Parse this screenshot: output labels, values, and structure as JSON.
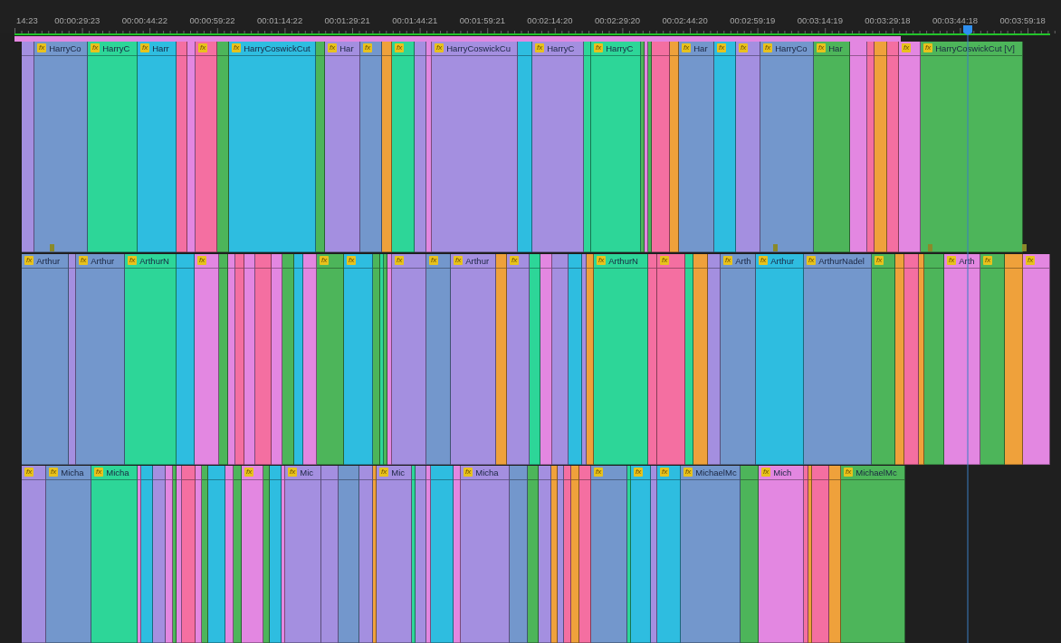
{
  "ruler": {
    "timecodes": [
      "14:23",
      "00:00:29:23",
      "00:00:44:22",
      "00:00:59:22",
      "00:01:14:22",
      "00:01:29:21",
      "00:01:44:21",
      "00:01:59:21",
      "00:02:14:20",
      "00:02:29:20",
      "00:02:44:20",
      "00:02:59:19",
      "00:03:14:19",
      "00:03:29:18",
      "00:03:44:18",
      "00:03:59:18"
    ]
  },
  "tracks": [
    {
      "clips": [
        {
          "color": "#a48fe0"
        },
        {
          "color": "#7397cc",
          "badge": "fx",
          "label": "HarryCo"
        },
        {
          "color": "#2dd698",
          "badge": "fx",
          "label": "HarryC"
        },
        {
          "color": "#2ebde0",
          "badge": "fx",
          "label": "Harr"
        },
        {
          "color": "#f46fa1"
        },
        {
          "color": "#e387e1"
        },
        {
          "color": "#f46fa1",
          "badge": "fx"
        },
        {
          "color": "#4db55a"
        },
        {
          "color": "#2ebde0",
          "badge": "fx",
          "label": "HarryCoswickCut"
        },
        {
          "color": "#4db55a"
        },
        {
          "color": "#a48fe0",
          "badge": "fx",
          "label": "Har"
        },
        {
          "color": "#7397cc",
          "badge": "fx"
        },
        {
          "color": "#efa13b"
        },
        {
          "color": "#2dd698",
          "badge": "fx"
        },
        {
          "color": "#a48fe0"
        },
        {
          "color": "#e387e1"
        },
        {
          "color": "#a48fe0",
          "badge": "fx",
          "label": "HarryCoswickCu"
        },
        {
          "color": "#2ebde0"
        },
        {
          "color": "#a48fe0",
          "badge": "fx",
          "label": "HarryC"
        },
        {
          "color": "#2dd698"
        },
        {
          "color": "#2dd698",
          "badge": "fx",
          "label": "HarryC"
        },
        {
          "color": "#4db55a"
        },
        {
          "color": "#e387e1"
        },
        {
          "color": "#4db55a"
        },
        {
          "color": "#f46fa1"
        },
        {
          "color": "#efa13b"
        },
        {
          "color": "#7397cc",
          "badge": "fx",
          "label": "Har"
        },
        {
          "color": "#2ebde0",
          "badge": "fx"
        },
        {
          "color": "#a48fe0",
          "badge": "fx"
        },
        {
          "color": "#7397cc",
          "badge": "fx",
          "label": "HarryCo"
        },
        {
          "color": "#4db55a",
          "badge": "fx",
          "label": "Har"
        },
        {
          "color": "#e387e1"
        },
        {
          "color": "#f46fa1"
        },
        {
          "color": "#efa13b"
        },
        {
          "color": "#f46fa1"
        },
        {
          "color": "#e387e1",
          "badge": "fx"
        },
        {
          "color": "#4db55a",
          "badge": "fx",
          "label": "HarryCoswickCut [V]"
        }
      ]
    },
    {
      "clips": [
        {
          "color": "#7397cc",
          "badge": "fx",
          "label": "Arthur"
        },
        {
          "color": "#a48fe0"
        },
        {
          "color": "#7397cc",
          "badge": "fx",
          "label": "Arthur"
        },
        {
          "color": "#2dd698",
          "badge": "fx",
          "label": "ArthurN"
        },
        {
          "color": "#2ebde0"
        },
        {
          "color": "#e387e1",
          "badge": "fx"
        },
        {
          "color": "#4db55a"
        },
        {
          "color": "#e387e1"
        },
        {
          "color": "#f46fa1"
        },
        {
          "color": "#e387e1"
        },
        {
          "color": "#f46fa1"
        },
        {
          "color": "#e387e1"
        },
        {
          "color": "#4db55a"
        },
        {
          "color": "#2ebde0"
        },
        {
          "color": "#e387e1"
        },
        {
          "color": "#4db55a",
          "badge": "fx"
        },
        {
          "color": "#2ebde0",
          "badge": "fx"
        },
        {
          "color": "#4db55a"
        },
        {
          "color": "#2dd698"
        },
        {
          "color": "#4db55a"
        },
        {
          "color": "#e387e1"
        },
        {
          "color": "#a48fe0",
          "badge": "fx"
        },
        {
          "color": "#7397cc",
          "badge": "fx"
        },
        {
          "color": "#a48fe0",
          "badge": "fx",
          "label": "Arthur"
        },
        {
          "color": "#efa13b"
        },
        {
          "color": "#a48fe0",
          "badge": "fx"
        },
        {
          "color": "#2dd698"
        },
        {
          "color": "#e387e1"
        },
        {
          "color": "#a48fe0"
        },
        {
          "color": "#2ebde0"
        },
        {
          "color": "#a48fe0"
        },
        {
          "color": "#efa13b"
        },
        {
          "color": "#2dd698",
          "badge": "fx",
          "label": "ArthurN"
        },
        {
          "color": "#f46fa1"
        },
        {
          "color": "#f46fa1",
          "badge": "fx"
        },
        {
          "color": "#2dd698"
        },
        {
          "color": "#efa13b"
        },
        {
          "color": "#a48fe0"
        },
        {
          "color": "#7397cc",
          "badge": "fx",
          "label": "Arth"
        },
        {
          "color": "#2ebde0",
          "badge": "fx",
          "label": "Arthur"
        },
        {
          "color": "#7397cc",
          "badge": "fx",
          "label": "ArthurNadel"
        },
        {
          "color": "#4db55a",
          "badge": "fx"
        },
        {
          "color": "#efa13b"
        },
        {
          "color": "#f46fa1"
        },
        {
          "color": "#efa13b"
        },
        {
          "color": "#4db55a"
        },
        {
          "color": "#e387e1",
          "badge": "fx",
          "label": "Arth"
        },
        {
          "color": "#4db55a",
          "badge": "fx"
        },
        {
          "color": "#efa13b"
        },
        {
          "color": "#e387e1",
          "badge": "fx"
        }
      ]
    },
    {
      "clips": [
        {
          "color": "#a48fe0",
          "badge": "fx"
        },
        {
          "color": "#7397cc",
          "badge": "fx",
          "label": "Micha"
        },
        {
          "color": "#2dd698",
          "badge": "fx",
          "label": "Micha"
        },
        {
          "color": "#e387e1"
        },
        {
          "color": "#2ebde0"
        },
        {
          "color": "#a48fe0"
        },
        {
          "color": "#e387e1"
        },
        {
          "color": "#4db55a"
        },
        {
          "color": "#e387e1"
        },
        {
          "color": "#f46fa1"
        },
        {
          "color": "#e387e1"
        },
        {
          "color": "#4db55a"
        },
        {
          "color": "#2ebde0"
        },
        {
          "color": "#e387e1"
        },
        {
          "color": "#4db55a"
        },
        {
          "color": "#e387e1",
          "badge": "fx"
        },
        {
          "color": "#4db55a"
        },
        {
          "color": "#2ebde0"
        },
        {
          "color": "#e387e1"
        },
        {
          "color": "#a48fe0",
          "badge": "fx",
          "label": "Mic"
        },
        {
          "color": "#a48fe0"
        },
        {
          "color": "#7397cc"
        },
        {
          "color": "#a48fe0"
        },
        {
          "color": "#efa13b"
        },
        {
          "color": "#a48fe0",
          "badge": "fx",
          "label": "Mic"
        },
        {
          "color": "#2dd698"
        },
        {
          "color": "#a48fe0"
        },
        {
          "color": "#e387e1"
        },
        {
          "color": "#2ebde0"
        },
        {
          "color": "#e387e1"
        },
        {
          "color": "#a48fe0",
          "badge": "fx",
          "label": "Micha"
        },
        {
          "color": "#7397cc"
        },
        {
          "color": "#4db55a"
        },
        {
          "color": "#a48fe0"
        },
        {
          "color": "#efa13b"
        },
        {
          "color": "#a48fe0"
        },
        {
          "color": "#f46fa1"
        },
        {
          "color": "#efa13b"
        },
        {
          "color": "#f46fa1"
        },
        {
          "color": "#7397cc",
          "badge": "fx"
        },
        {
          "color": "#2dd698"
        },
        {
          "color": "#2ebde0",
          "badge": "fx"
        },
        {
          "color": "#a48fe0"
        },
        {
          "color": "#2ebde0",
          "badge": "fx"
        },
        {
          "color": "#7397cc",
          "badge": "fx",
          "label": "MichaelMc"
        },
        {
          "color": "#4db55a"
        },
        {
          "color": "#e387e1",
          "badge": "fx",
          "label": "Mich"
        },
        {
          "color": "#f46fa1"
        },
        {
          "color": "#efa13b"
        },
        {
          "color": "#f46fa1"
        },
        {
          "color": "#efa13b"
        },
        {
          "color": "#4db55a",
          "badge": "fx",
          "label": "MichaelMc"
        }
      ]
    }
  ]
}
